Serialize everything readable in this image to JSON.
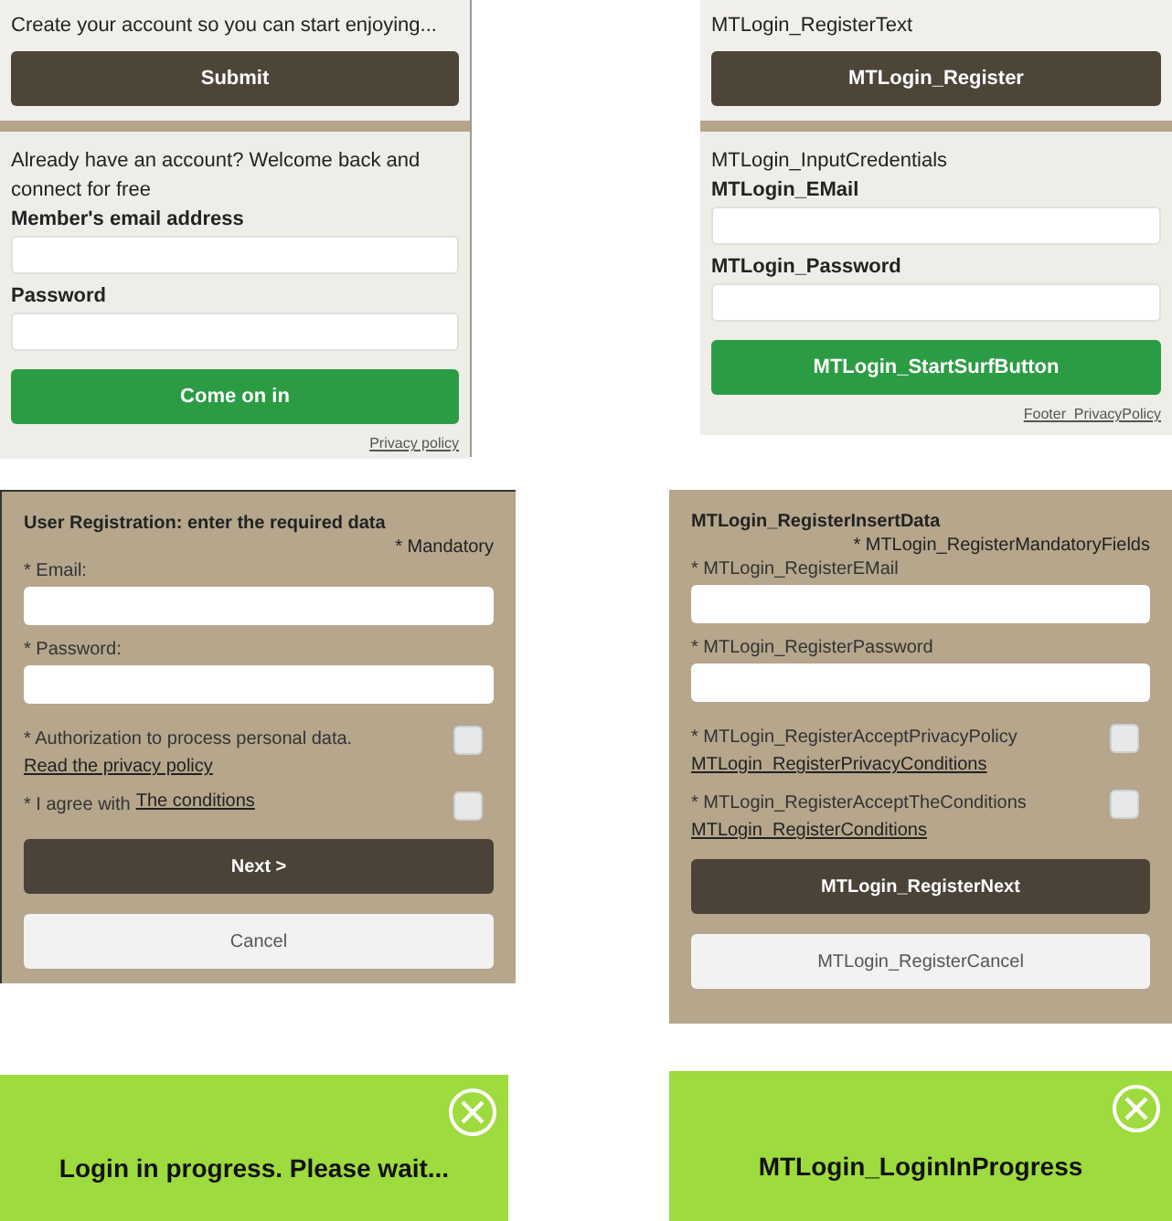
{
  "panels": [
    {
      "kind": "login",
      "register_text": "Create your account so you can start enjoying...",
      "register_button": "Submit",
      "intro_text": "Already have an account? Welcome back and connect for free",
      "email_label": "Member's email address",
      "password_label": "Password",
      "login_button": "Come on in",
      "privacy_link": "Privacy policy"
    },
    {
      "kind": "login",
      "register_text": "MTLogin_RegisterText",
      "register_button": "MTLogin_Register",
      "intro_text": "MTLogin_InputCredentials",
      "email_label": "MTLogin_EMail",
      "password_label": "MTLogin_Password",
      "login_button": "MTLogin_StartSurfButton",
      "privacy_link": "Footer_PrivacyPolicy"
    },
    {
      "kind": "register",
      "title": "User Registration: enter the required data",
      "mandatory": "* Mandatory",
      "email_label": "* Email:",
      "password_label": "* Password:",
      "checks": [
        {
          "kind": "stacked",
          "label": "* Authorization to process personal data.",
          "link": "Read the privacy policy",
          "checked": false
        },
        {
          "kind": "inline",
          "label": "* I agree with",
          "link": "The conditions",
          "checked": false
        }
      ],
      "next_button": "Next >",
      "cancel_button": "Cancel"
    },
    {
      "kind": "register",
      "title": "MTLogin_RegisterInsertData",
      "mandatory": "* MTLogin_RegisterMandatoryFields",
      "email_label": "* MTLogin_RegisterEMail",
      "password_label": "* MTLogin_RegisterPassword",
      "checks": [
        {
          "kind": "stacked",
          "label": "* MTLogin_RegisterAcceptPrivacyPolicy",
          "link": "MTLogin_RegisterPrivacyConditions",
          "checked": false
        },
        {
          "kind": "stacked",
          "label": "* MTLogin_RegisterAcceptTheConditions",
          "link": "MTLogin_RegisterConditions",
          "checked": false
        }
      ],
      "next_button": "MTLogin_RegisterNext",
      "cancel_button": "MTLogin_RegisterCancel"
    },
    {
      "kind": "progress",
      "text": "Login in progress. Please wait..."
    },
    {
      "kind": "progress",
      "text": "MTLogin_LoginInProgress"
    }
  ]
}
